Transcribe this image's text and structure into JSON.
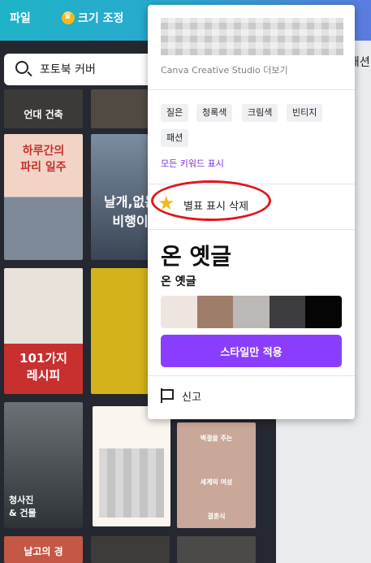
{
  "topbar": {
    "file_label": "파일",
    "resize_label": "크기 조정"
  },
  "search": {
    "value": "포토북 커버"
  },
  "right_strip": {
    "partial_label": "쇄션"
  },
  "templates": {
    "tile_1_title": "언대 건축",
    "tile_2_title": "하루간의\n파리 일주",
    "tile_3_title": "날개,없는\n비행이",
    "tile_4_title": "101가지\n레시피",
    "tile_5_title": "청사진\n& 건물",
    "tile_6_line1": "벽결을 주는",
    "tile_6_line2": "세계의 여성",
    "tile_6_line3": "결혼식",
    "tile_7_title": "날고의 경"
  },
  "popup": {
    "author": "Canva Creative Studio 더보기",
    "keywords": [
      "질은",
      "청록색",
      "크림색",
      "빈티지",
      "패션"
    ],
    "show_all_keywords": "모든 키워드 표시",
    "unstar_label": "별표 표시 삭제",
    "font_big": "온 옛글",
    "font_small": "온 옛글",
    "palette": [
      "#efe5e0",
      "#9f7d6b",
      "#bcb8b6",
      "#3d3c3f",
      "#050505"
    ],
    "apply_style_button": "스타일만 적용",
    "report_label": "신고"
  },
  "colors": {
    "accent": "#8b3dff",
    "star": "#f5b91e",
    "highlight_ring": "#e0161c"
  }
}
